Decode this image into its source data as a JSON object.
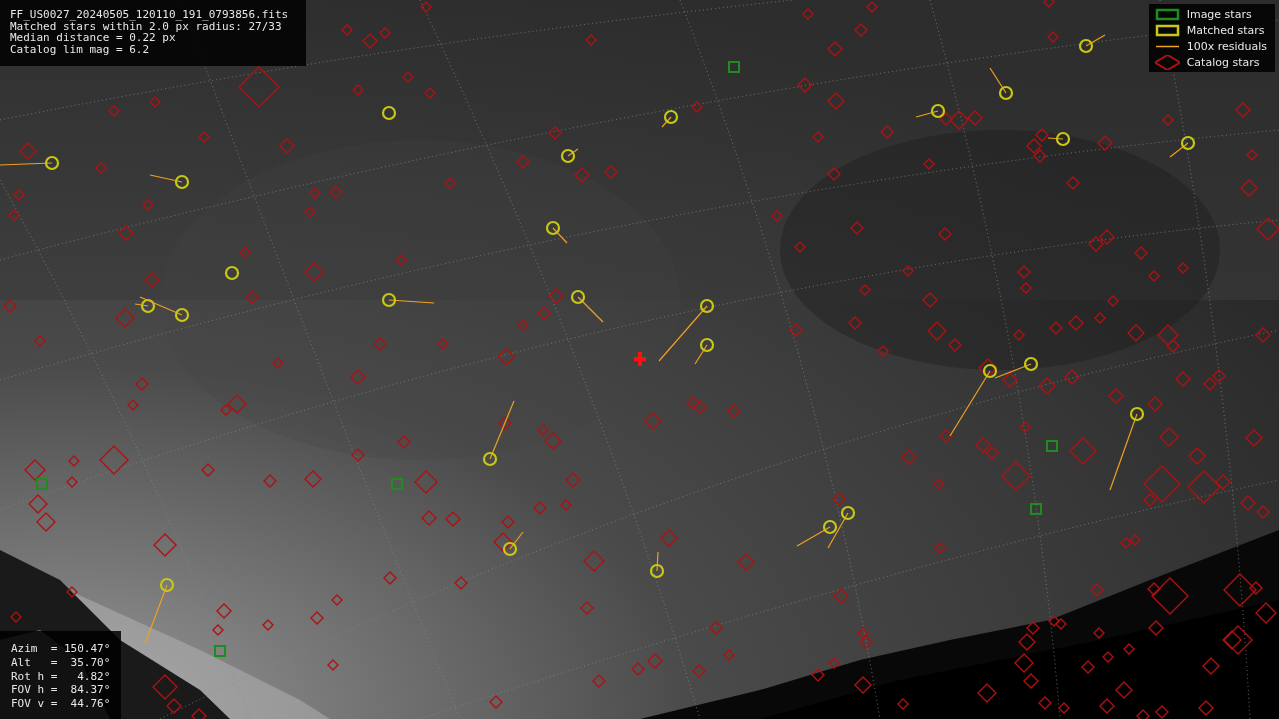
{
  "info_box": {
    "lines": [
      "FF_US0027_20240505_120110_191_0793856.fits",
      "Matched stars within 2.0 px radius: 27/33",
      "Median distance = 0.22 px",
      "Catalog lim mag = 6.2"
    ]
  },
  "legend": [
    {
      "label": "Image stars",
      "color": "#1e8c1e"
    },
    {
      "kind": "matched",
      "label": "Matched stars",
      "color": "#c8c814"
    },
    {
      "kind": "residual",
      "label": "100x residuals",
      "color": "#f0a020"
    },
    {
      "kind": "catalog",
      "label": "Catalog stars",
      "color": "#b01010"
    }
  ],
  "pointing_box": {
    "lines": [
      "Azim  = 150.47°",
      "Alt   =  35.70°",
      "Rot h =   4.82°",
      "FOV h =  84.37°",
      "FOV v =  44.76°"
    ]
  }
}
